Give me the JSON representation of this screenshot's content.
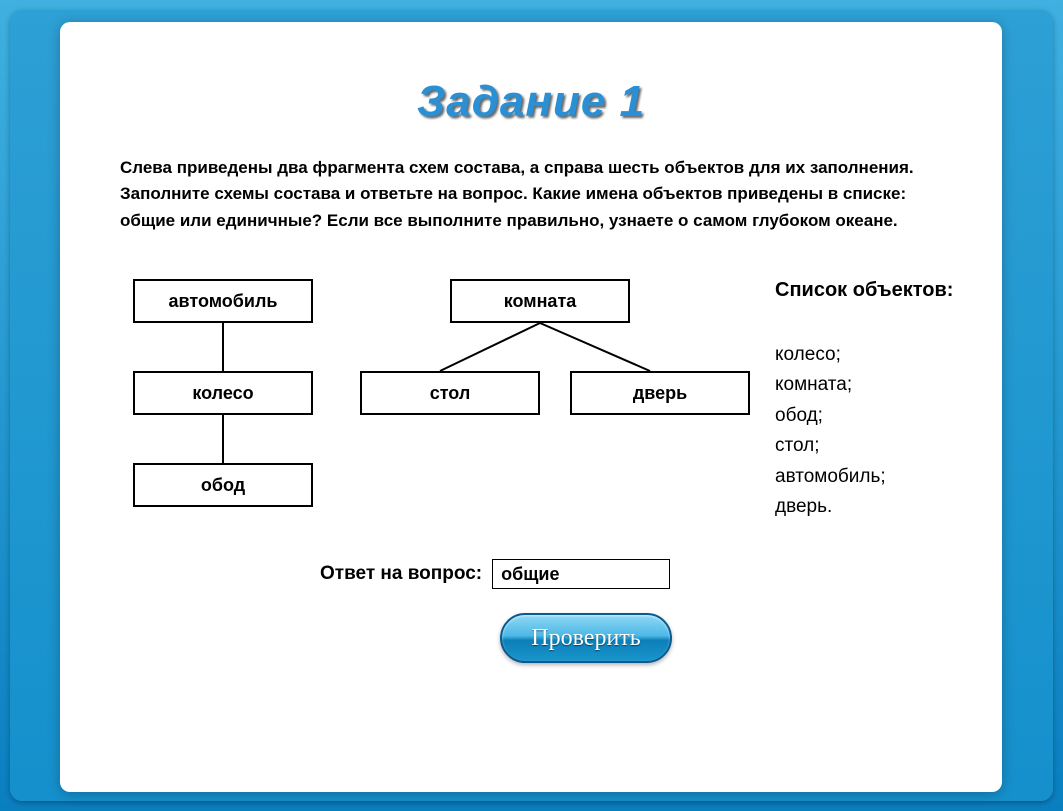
{
  "title": "Задание 1",
  "instructions": "Слева приведены два фрагмента схем состава, а справа шесть объектов для их заполнения. Заполните схемы состава и ответьте на вопрос. Какие имена объектов приведены в списке: общие или единичные? Если все выполните правильно, узнаете о самом глубоком океане.",
  "diagram": {
    "left": {
      "root": "автомобиль",
      "child": "колесо",
      "grandchild": "обод"
    },
    "right": {
      "root": "комната",
      "child1": "стол",
      "child2": "дверь"
    }
  },
  "sidebar": {
    "title": "Список объектов:",
    "items": [
      "колесо;",
      "комната;",
      "обод;",
      "стол;",
      "автомобиль;",
      "дверь."
    ]
  },
  "answer": {
    "label": "Ответ на вопрос:",
    "value": "общие"
  },
  "button": {
    "check": "Проверить"
  }
}
